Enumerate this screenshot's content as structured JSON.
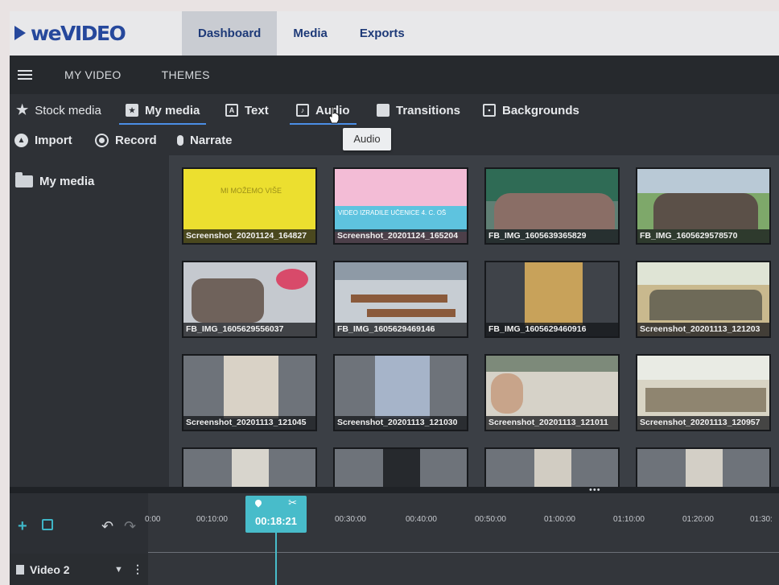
{
  "brand": {
    "name": "weVIDEO",
    "color": "#26489c",
    "accent": "#48bcca"
  },
  "topnav": {
    "dashboard": "Dashboard",
    "media": "Media",
    "exports": "Exports"
  },
  "subnav": {
    "my_video": "MY VIDEO",
    "themes": "THEMES"
  },
  "media_tabs": {
    "stock": "Stock media",
    "my_media": "My media",
    "text": "Text",
    "audio": "Audio",
    "transitions": "Transitions",
    "backgrounds": "Backgrounds"
  },
  "tooltip": "Audio",
  "actions": {
    "import": "Import",
    "record": "Record",
    "narrate": "Narrate"
  },
  "sidebar": {
    "folder": "My media"
  },
  "thumb_overlays": {
    "t1": "MI MOŽEMO VIŠE",
    "t2": "VIDEO IZRADILE UČENICE 4. C. OŠ"
  },
  "media_items": [
    "Screenshot_20201124_164827",
    "Screenshot_20201124_165204",
    "FB_IMG_1605639365829",
    "FB_IMG_1605629578570",
    "FB_IMG_1605629556037",
    "FB_IMG_1605629469146",
    "FB_IMG_1605629460916",
    "Screenshot_20201113_121203",
    "Screenshot_20201113_121045",
    "Screenshot_20201113_121030",
    "Screenshot_20201113_121011",
    "Screenshot_20201113_120957"
  ],
  "timeline": {
    "playhead_time": "00:18:21",
    "ticks": [
      "0:00",
      "00:10:00",
      "00:30:00",
      "00:40:00",
      "00:50:00",
      "01:00:00",
      "01:10:00",
      "01:20:00",
      "01:30:"
    ],
    "track_label": "Video 2"
  }
}
